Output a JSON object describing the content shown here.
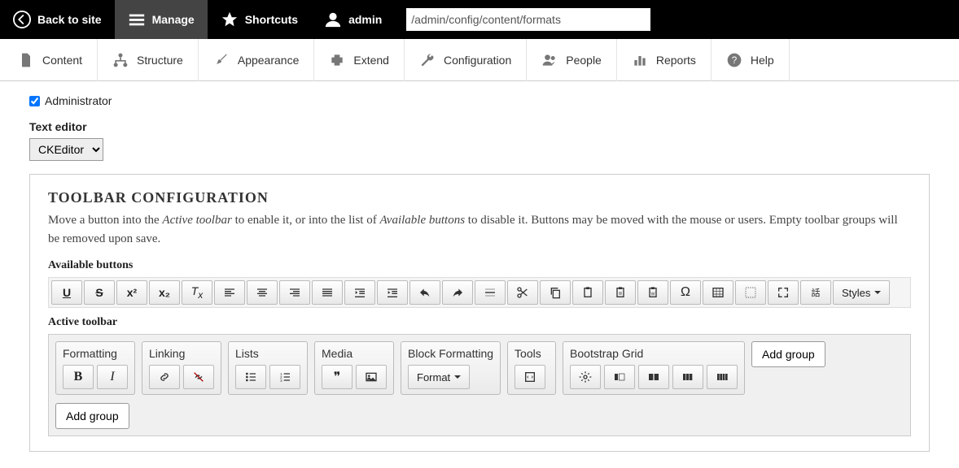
{
  "topbar": {
    "back": "Back to site",
    "manage": "Manage",
    "shortcuts": "Shortcuts",
    "user": "admin",
    "url": "/admin/config/content/formats"
  },
  "adminmenu": {
    "content": "Content",
    "structure": "Structure",
    "appearance": "Appearance",
    "extend": "Extend",
    "configuration": "Configuration",
    "people": "People",
    "reports": "Reports",
    "help": "Help"
  },
  "role_checkbox": "Administrator",
  "text_editor_label": "Text editor",
  "text_editor_value": "CKEditor",
  "toolbar": {
    "title": "TOOLBAR CONFIGURATION",
    "desc_1": "Move a button into the ",
    "desc_em1": "Active toolbar",
    "desc_2": " to enable it, or into the list of ",
    "desc_em2": "Available buttons",
    "desc_3": " to disable it. Buttons may be moved with the mouse or users. Empty toolbar groups will be removed upon save.",
    "available_label": "Available buttons",
    "active_label": "Active toolbar",
    "styles_btn": "Styles",
    "format_btn": "Format",
    "add_group": "Add group",
    "groups": {
      "formatting": "Formatting",
      "linking": "Linking",
      "lists": "Lists",
      "media": "Media",
      "block": "Block Formatting",
      "tools": "Tools",
      "bootstrap": "Bootstrap Grid"
    },
    "icons": {
      "bold": "B",
      "italic": "I",
      "underline": "U",
      "strike": "S",
      "omega": "Ω",
      "quotes": "❞"
    }
  }
}
